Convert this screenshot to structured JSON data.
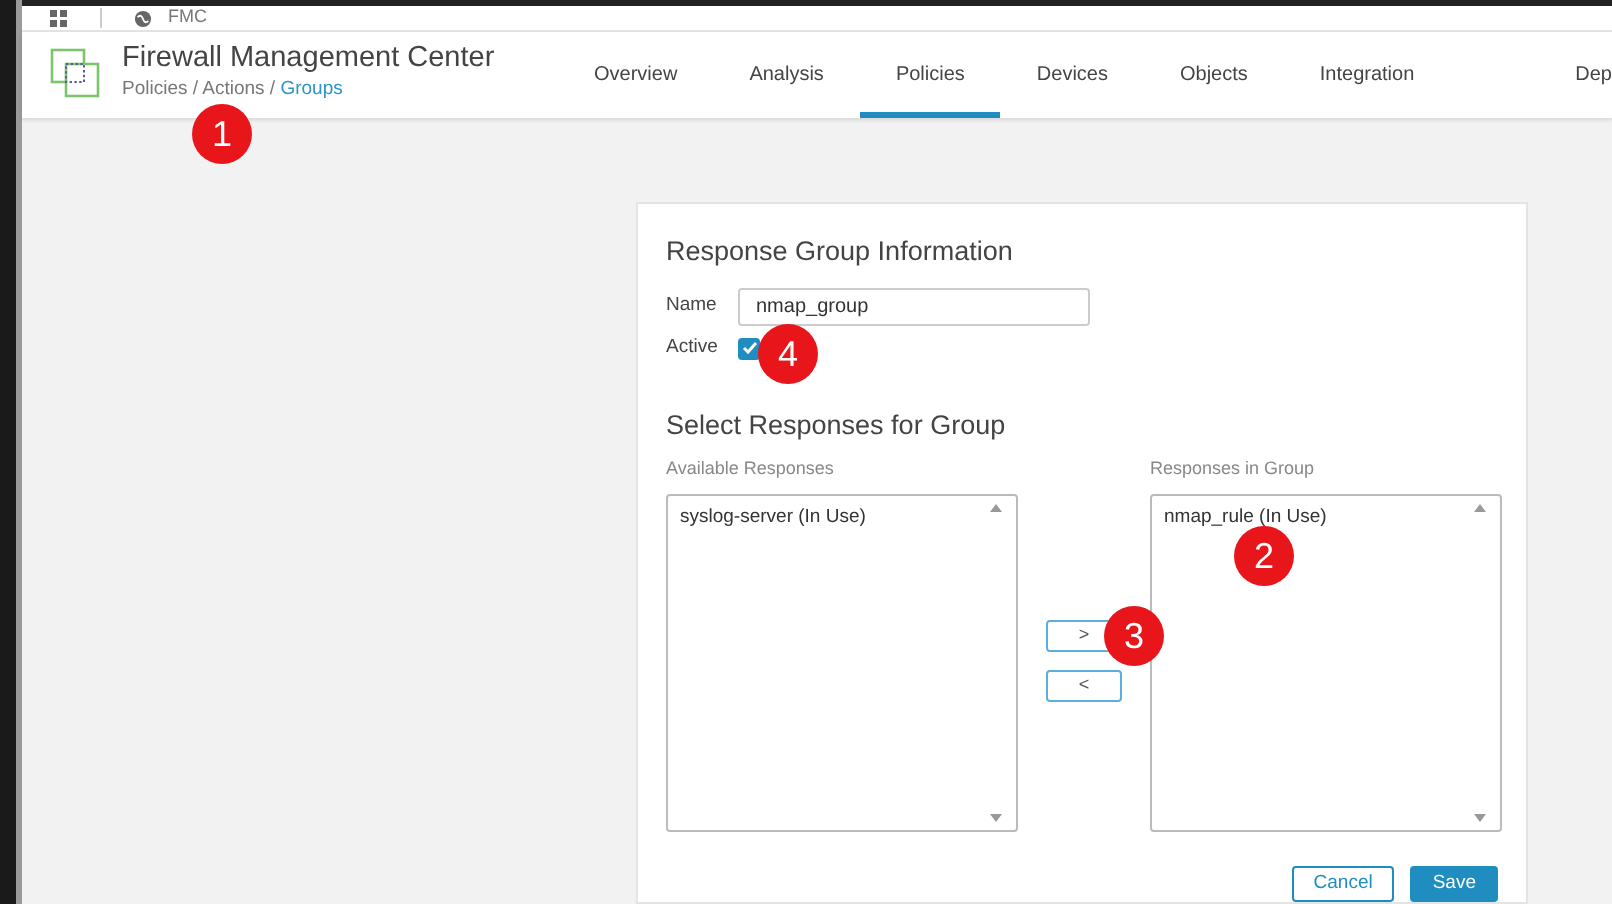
{
  "browser_tab": {
    "title": "FMC"
  },
  "header": {
    "title": "Firewall Management Center",
    "breadcrumb": "Policies / Actions / ",
    "breadcrumb_link": "Groups"
  },
  "nav": [
    {
      "label": "Overview",
      "selected": false
    },
    {
      "label": "Analysis",
      "selected": false
    },
    {
      "label": "Policies",
      "selected": true
    },
    {
      "label": "Devices",
      "selected": false
    },
    {
      "label": "Objects",
      "selected": false
    },
    {
      "label": "Integration",
      "selected": false
    },
    {
      "label": "Dep",
      "selected": false
    }
  ],
  "form": {
    "heading": "Response Group Information",
    "name_label": "Name",
    "name_value": "nmap_group",
    "active_label": "Active",
    "active_checked": true,
    "select_heading": "Select Responses for Group",
    "available": {
      "label": "Available Responses",
      "items": [
        "syslog-server (In Use)"
      ]
    },
    "move_buttons": [
      ">",
      "<"
    ],
    "in_group": {
      "label": "Responses in Group",
      "items": [
        "nmap_rule (In Use)"
      ]
    },
    "buttons": [
      {
        "label": "Cancel",
        "kind": "secondary"
      },
      {
        "label": "Save",
        "kind": "primary"
      }
    ]
  },
  "callouts": [
    "1",
    "2",
    "3",
    "4"
  ]
}
